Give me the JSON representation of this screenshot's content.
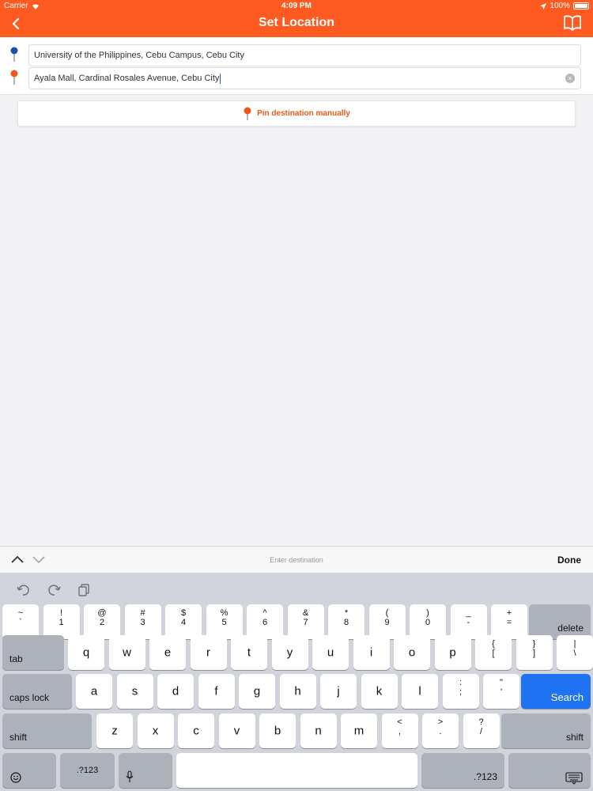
{
  "status_bar": {
    "carrier": "Carrier",
    "time": "4:09 PM",
    "battery": "100%"
  },
  "nav": {
    "title": "Set Location",
    "back_icon": "chevron-left-icon",
    "book_icon": "book-icon"
  },
  "locations": {
    "origin": "University of the Philippines, Cebu Campus, Cebu City",
    "destination": "Ayala Mall, Cardinal Rosales Avenue, Cebu City"
  },
  "pin_button": {
    "label": "Pin destination manually"
  },
  "accessory": {
    "placeholder": "Enter destination",
    "done": "Done"
  },
  "keyboard": {
    "number_row": [
      {
        "top": "~",
        "bottom": "`"
      },
      {
        "top": "!",
        "bottom": "1"
      },
      {
        "top": "@",
        "bottom": "2"
      },
      {
        "top": "#",
        "bottom": "3"
      },
      {
        "top": "$",
        "bottom": "4"
      },
      {
        "top": "%",
        "bottom": "5"
      },
      {
        "top": "^",
        "bottom": "6"
      },
      {
        "top": "&",
        "bottom": "7"
      },
      {
        "top": "*",
        "bottom": "8"
      },
      {
        "top": "(",
        "bottom": "9"
      },
      {
        "top": ")",
        "bottom": "0"
      },
      {
        "top": "_",
        "bottom": "-"
      },
      {
        "top": "+",
        "bottom": "="
      }
    ],
    "delete": "delete",
    "tab": "tab",
    "row_q": [
      "q",
      "w",
      "e",
      "r",
      "t",
      "y",
      "u",
      "i",
      "o",
      "p"
    ],
    "row_q_symbols": [
      {
        "top": "{",
        "bottom": "["
      },
      {
        "top": "}",
        "bottom": "]"
      },
      {
        "top": "|",
        "bottom": "\\"
      }
    ],
    "caps_lock": "caps lock",
    "row_a": [
      "a",
      "s",
      "d",
      "f",
      "g",
      "h",
      "j",
      "k",
      "l"
    ],
    "row_a_symbols": [
      {
        "top": ":",
        "bottom": ";"
      },
      {
        "top": "\"",
        "bottom": "'"
      }
    ],
    "search": "Search",
    "shift": "shift",
    "row_z": [
      "z",
      "x",
      "c",
      "v",
      "b",
      "n",
      "m"
    ],
    "row_z_symbols": [
      {
        "top": "<",
        "bottom": ","
      },
      {
        "top": ">",
        "bottom": "."
      },
      {
        "top": "?",
        "bottom": "/"
      }
    ],
    "numbers_key": ".?123",
    "emoji_icon": "emoji-icon",
    "mic_icon": "microphone-icon",
    "hide_icon": "keyboard-hide-icon"
  },
  "colors": {
    "brand": "#ff5a1f",
    "search_key": "#1f73f2"
  }
}
